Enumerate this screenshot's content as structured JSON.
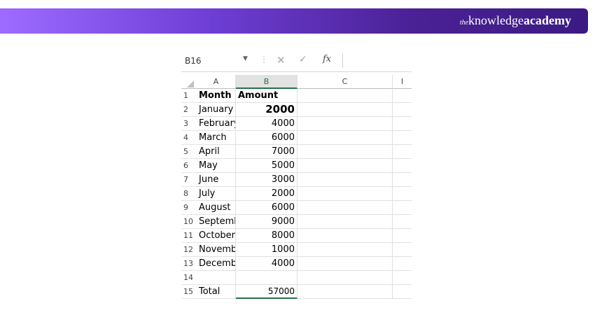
{
  "brand": {
    "prefix": "the",
    "regular": "knowledge",
    "bold": "academy"
  },
  "formula_bar": {
    "name_box": "B16",
    "cancel": "✕",
    "enter": "✓",
    "fx": "fx"
  },
  "columns": [
    "A",
    "B",
    "C",
    "I"
  ],
  "rows": [
    {
      "n": "1",
      "a": "Month",
      "b": "Amount"
    },
    {
      "n": "2",
      "a": "January",
      "b": "2000"
    },
    {
      "n": "3",
      "a": "February",
      "b": "4000"
    },
    {
      "n": "4",
      "a": "March",
      "b": "6000"
    },
    {
      "n": "5",
      "a": "April",
      "b": "7000"
    },
    {
      "n": "6",
      "a": "May",
      "b": "5000"
    },
    {
      "n": "7",
      "a": "June",
      "b": "3000"
    },
    {
      "n": "8",
      "a": "July",
      "b": "2000"
    },
    {
      "n": "9",
      "a": "August",
      "b": "6000"
    },
    {
      "n": "10",
      "a": "Septemb",
      "b": "9000"
    },
    {
      "n": "11",
      "a": "October",
      "b": "8000"
    },
    {
      "n": "12",
      "a": "Novembe",
      "b": "1000"
    },
    {
      "n": "13",
      "a": "Decembe",
      "b": "4000"
    },
    {
      "n": "14",
      "a": "",
      "b": ""
    },
    {
      "n": "15",
      "a": "Total",
      "b": "57000"
    }
  ]
}
